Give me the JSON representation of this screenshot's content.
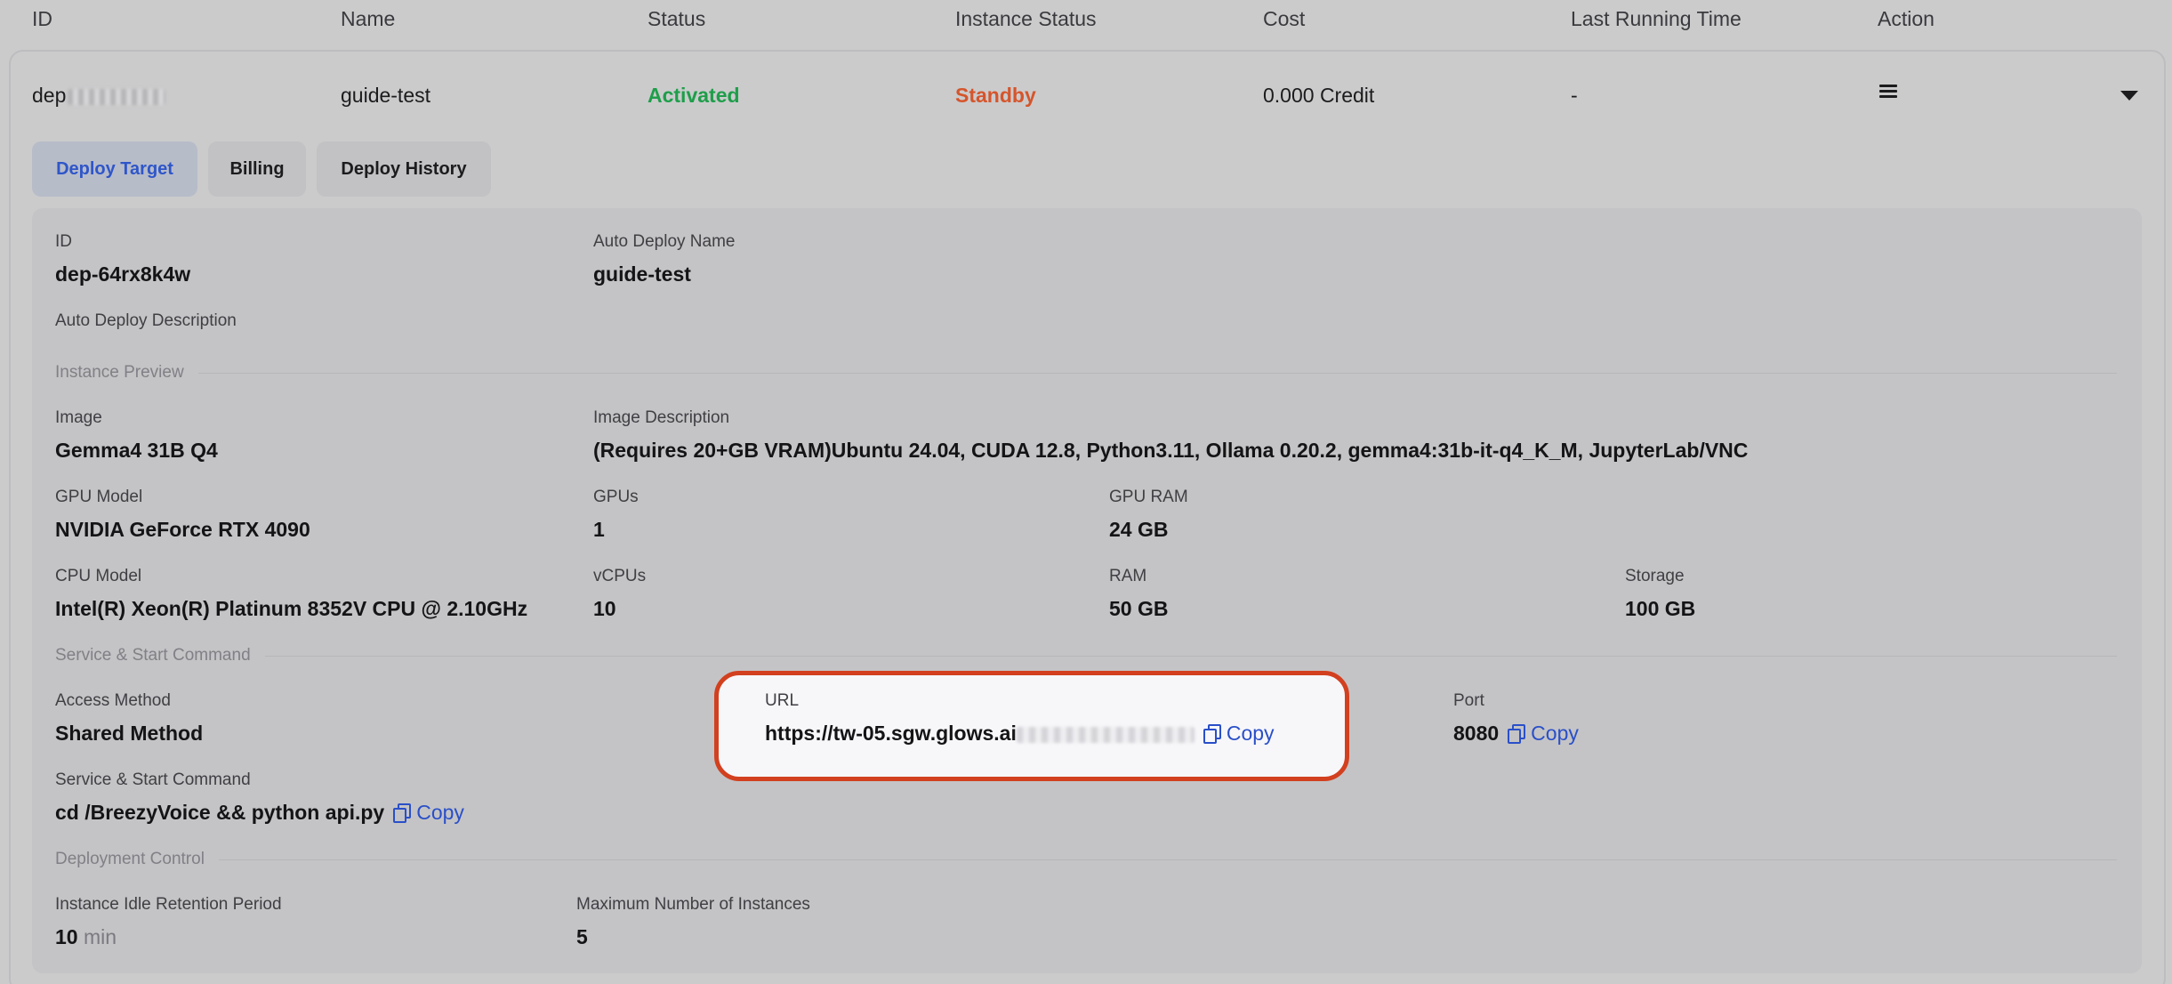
{
  "table_header": {
    "id": "ID",
    "name": "Name",
    "status": "Status",
    "instance_status": "Instance Status",
    "cost": "Cost",
    "last_running_time": "Last Running Time",
    "action": "Action"
  },
  "row": {
    "id_prefix": "dep",
    "name": "guide-test",
    "status": "Activated",
    "instance_status": "Standby",
    "cost": "0.000 Credit",
    "last_running_time": "-"
  },
  "tabs": [
    {
      "label": "Deploy Target",
      "active": true
    },
    {
      "label": "Billing",
      "active": false
    },
    {
      "label": "Deploy History",
      "active": false
    }
  ],
  "details": {
    "id_label": "ID",
    "id_value": "dep-64rx8k4w",
    "auto_deploy_name_label": "Auto Deploy Name",
    "auto_deploy_name_value": "guide-test",
    "auto_deploy_description_label": "Auto Deploy Description",
    "instance_preview_section": "Instance Preview",
    "image_label": "Image",
    "image_value": "Gemma4 31B Q4",
    "image_description_label": "Image Description",
    "image_description_value": "(Requires 20+GB VRAM)Ubuntu 24.04, CUDA 12.8, Python3.11, Ollama 0.20.2, gemma4:31b-it-q4_K_M, JupyterLab/VNC",
    "gpu_model_label": "GPU Model",
    "gpu_model_value": "NVIDIA GeForce RTX 4090",
    "gpus_label": "GPUs",
    "gpus_value": "1",
    "gpu_ram_label": "GPU RAM",
    "gpu_ram_value": "24 GB",
    "cpu_model_label": "CPU Model",
    "cpu_model_value": "Intel(R) Xeon(R) Platinum 8352V CPU @ 2.10GHz",
    "vcpus_label": "vCPUs",
    "vcpus_value": "10",
    "ram_label": "RAM",
    "ram_value": "50 GB",
    "storage_label": "Storage",
    "storage_value": "100 GB",
    "service_section": "Service & Start Command",
    "access_method_label": "Access Method",
    "access_method_value": "Shared Method",
    "url_label": "URL",
    "url_value_visible": "https://tw-05.sgw.glows.ai",
    "port_label": "Port",
    "port_value": "8080",
    "service_command_label": "Service & Start Command",
    "service_command_value": "cd /BreezyVoice && python api.py",
    "copy_label": "Copy",
    "deployment_control_section": "Deployment Control",
    "idle_retention_label": "Instance Idle Retention Period",
    "idle_retention_value": "10",
    "idle_retention_unit": "min",
    "max_instances_label": "Maximum Number of Instances",
    "max_instances_value": "5"
  },
  "colors": {
    "status_activated": "#1e9e4a",
    "status_standby": "#d5552b",
    "link_blue": "#2a4fc8",
    "highlight_border": "#d2401f"
  },
  "icons": [
    "menu-icon",
    "chevron-down-icon",
    "copy-icon"
  ]
}
